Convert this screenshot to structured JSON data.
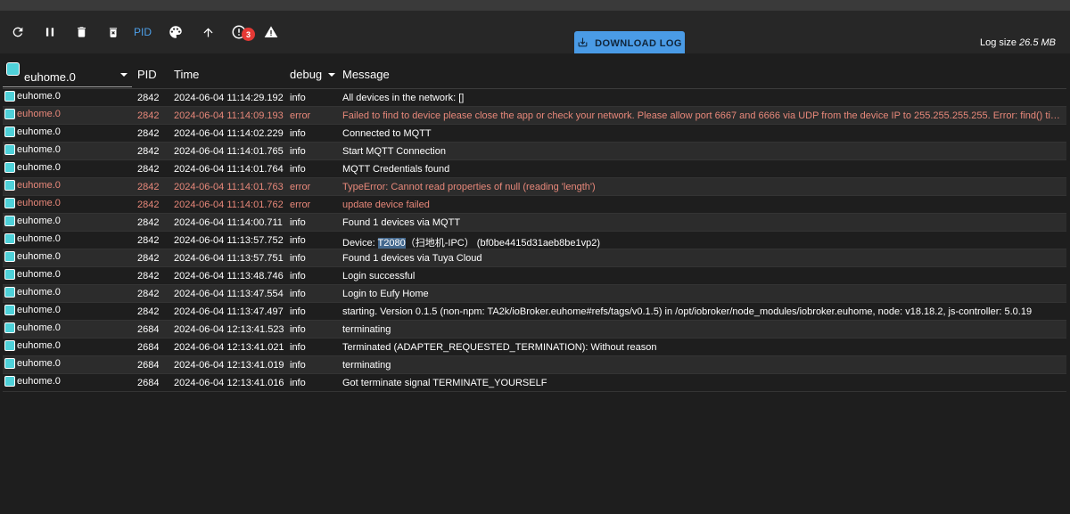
{
  "toolbar": {
    "pid_label": "PID",
    "badge_count": "3",
    "download_label": "DOWNLOAD LOG",
    "log_size_label": "Log size",
    "log_size_value": "26.5 MB"
  },
  "table": {
    "source_filter": "euhome.0",
    "headers": {
      "pid": "PID",
      "time": "Time",
      "level": "debug",
      "message": "Message"
    },
    "rows": [
      {
        "src": "euhome.0",
        "pid": "2842",
        "time": "2024-06-04 11:14:29.192",
        "level": "info",
        "msg": "All devices in the network: []"
      },
      {
        "src": "euhome.0",
        "pid": "2842",
        "time": "2024-06-04 11:14:09.193",
        "level": "error",
        "msg": "Failed to find to device please close the app or check your network. Please allow port 6667 and 6666 via UDP from the device IP to 255.255.255.255. Error: find() timed out. Is the device powered on and the ID or IP correct?"
      },
      {
        "src": "euhome.0",
        "pid": "2842",
        "time": "2024-06-04 11:14:02.229",
        "level": "info",
        "msg": "Connected to MQTT"
      },
      {
        "src": "euhome.0",
        "pid": "2842",
        "time": "2024-06-04 11:14:01.765",
        "level": "info",
        "msg": "Start MQTT Connection"
      },
      {
        "src": "euhome.0",
        "pid": "2842",
        "time": "2024-06-04 11:14:01.764",
        "level": "info",
        "msg": "MQTT Credentials found"
      },
      {
        "src": "euhome.0",
        "pid": "2842",
        "time": "2024-06-04 11:14:01.763",
        "level": "error",
        "msg": "TypeError: Cannot read properties of null (reading 'length')"
      },
      {
        "src": "euhome.0",
        "pid": "2842",
        "time": "2024-06-04 11:14:01.762",
        "level": "error",
        "msg": "update device failed"
      },
      {
        "src": "euhome.0",
        "pid": "2842",
        "time": "2024-06-04 11:14:00.711",
        "level": "info",
        "msg": "Found 1 devices via MQTT"
      },
      {
        "src": "euhome.0",
        "pid": "2842",
        "time": "2024-06-04 11:13:57.752",
        "level": "info",
        "msg_prefix": "Device: ",
        "msg_highlight": "T2080",
        "msg_suffix": "（扫地机-IPC） (bf0be4415d31aeb8be1vp2)"
      },
      {
        "src": "euhome.0",
        "pid": "2842",
        "time": "2024-06-04 11:13:57.751",
        "level": "info",
        "msg": "Found 1 devices via Tuya Cloud"
      },
      {
        "src": "euhome.0",
        "pid": "2842",
        "time": "2024-06-04 11:13:48.746",
        "level": "info",
        "msg": "Login successful"
      },
      {
        "src": "euhome.0",
        "pid": "2842",
        "time": "2024-06-04 11:13:47.554",
        "level": "info",
        "msg": "Login to Eufy Home"
      },
      {
        "src": "euhome.0",
        "pid": "2842",
        "time": "2024-06-04 11:13:47.497",
        "level": "info",
        "msg": "starting. Version 0.1.5 (non-npm: TA2k/ioBroker.euhome#refs/tags/v0.1.5) in /opt/iobroker/node_modules/iobroker.euhome, node: v18.18.2, js-controller: 5.0.19"
      },
      {
        "src": "euhome.0",
        "pid": "2684",
        "time": "2024-06-04 12:13:41.523",
        "level": "info",
        "msg": "terminating"
      },
      {
        "src": "euhome.0",
        "pid": "2684",
        "time": "2024-06-04 12:13:41.021",
        "level": "info",
        "msg": "Terminated (ADAPTER_REQUESTED_TERMINATION): Without reason"
      },
      {
        "src": "euhome.0",
        "pid": "2684",
        "time": "2024-06-04 12:13:41.019",
        "level": "info",
        "msg": "terminating"
      },
      {
        "src": "euhome.0",
        "pid": "2684",
        "time": "2024-06-04 12:13:41.016",
        "level": "info",
        "msg": "Got terminate signal TERMINATE_YOURSELF"
      }
    ]
  },
  "icons": [
    "refresh-icon",
    "pause-icon",
    "delete-icon",
    "clear-icon",
    "palette-icon",
    "arrow-up-icon",
    "alert-circle-icon",
    "warning-icon",
    "download-icon"
  ],
  "colors": {
    "accent": "#4a9be6",
    "error_text": "#e8887a",
    "badge": "#e53935",
    "source_square": "#4fd1d9"
  }
}
